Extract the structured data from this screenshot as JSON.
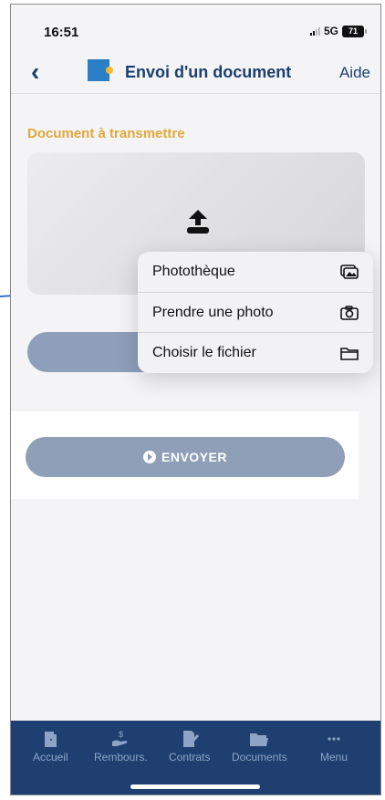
{
  "status_bar": {
    "time": "16:51",
    "network": "5G",
    "battery": "71"
  },
  "header": {
    "title": "Envoi d'un document",
    "help_label": "Aide",
    "back_icon": "chevron-left-icon"
  },
  "section": {
    "label": "Document à transmettre"
  },
  "upload": {
    "icon": "upload-icon"
  },
  "menu": {
    "items": [
      {
        "label": "Photothèque",
        "icon": "photo-library-icon"
      },
      {
        "label": "Prendre une photo",
        "icon": "camera-icon"
      },
      {
        "label": "Choisir le fichier",
        "icon": "folder-icon"
      }
    ]
  },
  "send_button": {
    "label": "ENVOYER",
    "icon": "arrow-circle-icon"
  },
  "bottom_nav": {
    "items": [
      {
        "label": "Accueil",
        "icon": "door-icon"
      },
      {
        "label": "Rembours.",
        "icon": "hand-coin-icon"
      },
      {
        "label": "Contrats",
        "icon": "document-pen-icon"
      },
      {
        "label": "Documents",
        "icon": "folder-open-icon"
      },
      {
        "label": "Menu",
        "icon": "more-icon"
      }
    ]
  },
  "colors": {
    "primary": "#1e3f70",
    "accent": "#e0a83a",
    "button_disabled": "#8f9fb7",
    "annotation_arrow": "#3a6fc4"
  }
}
